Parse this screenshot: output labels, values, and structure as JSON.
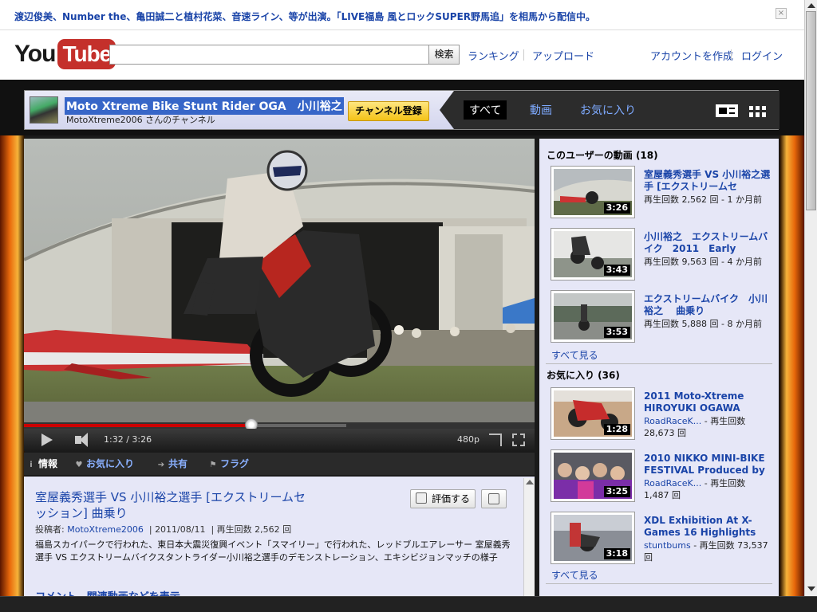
{
  "banner": {
    "message": "渡辺俊美、Number the、亀田誠二と植村花菜、音速ライン、等が出演。「LIVE福島 風とロックSUPER野馬追」を相馬から配信中。",
    "close": "×"
  },
  "header": {
    "logo_you": "You",
    "logo_tube": "Tube",
    "search_placeholder": "",
    "search_button": "検索",
    "links": {
      "ranking": "ランキング",
      "upload": "アップロード",
      "create_account": "アカウントを作成",
      "login": "ログイン"
    }
  },
  "channel": {
    "title": "Moto Xtreme Bike Stunt Rider OGA　小川裕之",
    "owner_line": "MotoXtreme2006 さんのチャンネル",
    "subscribe": "チャンネル登録",
    "tabs": [
      "すべて",
      "動画",
      "お気に入り"
    ],
    "active_tab": "すべて"
  },
  "player": {
    "current_time": "1:32",
    "duration": "3:26",
    "quality": "480p",
    "progress_fraction": 0.447
  },
  "info_tabs": {
    "info": "情報",
    "favorite": "お気に入り",
    "share": "共有",
    "flag": "フラグ"
  },
  "video": {
    "title": "室屋義秀選手 VS 小川裕之選手 [エクストリームセッション] 曲乗り",
    "like_label": "評価する",
    "meta_prefix": "投稿者:",
    "author": "MotoXtreme2006",
    "date": "2011/08/11",
    "views_label": "再生回数 2,562 回",
    "description": "福島スカイパークで行われた、東日本大震災復興イベント「スマイリー」で行われた、レッドブルエアレーサー 室屋義秀選手 VS エクストリームバイクスタントライダー小川裕之選手のデモンストレーション、エキシビジョンマッチの様子",
    "comments_heading": "コメント、関連動画などを表示"
  },
  "sidebar": {
    "uploads_heading": "このユーザーの動画 (18)",
    "uploads": [
      {
        "title": "室屋義秀選手 VS 小川裕之選手 [エクストリームセ",
        "meta": "再生回数 2,562 回 - 1 か月前",
        "duration": "3:26"
      },
      {
        "title": "小川裕之　エクストリームバイク　2011　Early",
        "meta": "再生回数 9,563 回 - 4 か月前",
        "duration": "3:43"
      },
      {
        "title": "エクストリームバイク　小川裕之　 曲乗り",
        "meta": "再生回数 5,888 回 - 8 か月前",
        "duration": "3:53"
      }
    ],
    "see_all_1": "すべて見る",
    "favorites_heading": "お気に入り (36)",
    "favorites": [
      {
        "title": "2011 Moto-Xtreme HIROYUKI OGAWA",
        "channel": "RoadRaceK...",
        "meta": " - 再生回数 28,673 回",
        "duration": "1:28"
      },
      {
        "title": "2010 NIKKO MINI-BIKE FESTIVAL Produced by",
        "channel": "RoadRaceK...",
        "meta": " - 再生回数 1,487 回",
        "duration": "3:25"
      },
      {
        "title": "XDL Exhibition At X-Games 16 Highlights",
        "channel": "stuntbums",
        "meta": " - 再生回数 73,537 回",
        "duration": "3:18"
      }
    ],
    "see_all_2": "すべて見る"
  }
}
